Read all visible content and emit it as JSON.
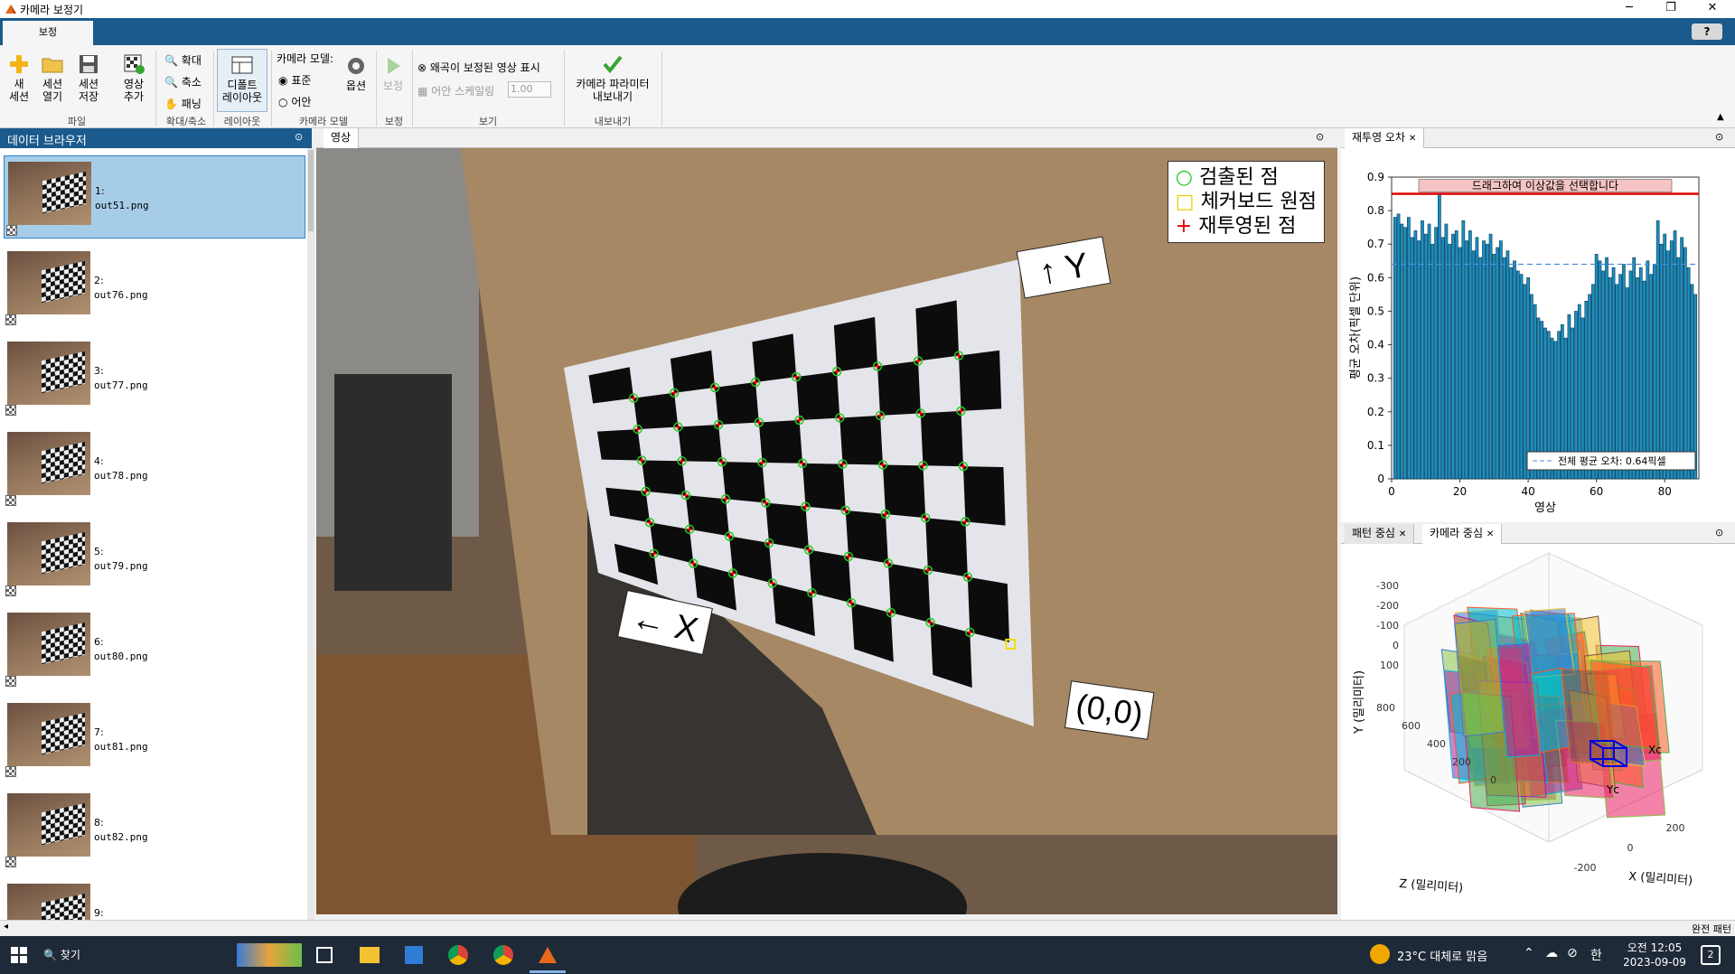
{
  "window": {
    "title": "카메라 보정기"
  },
  "ribbon": {
    "tab_label": "보정",
    "help": "?",
    "groups": {
      "file": {
        "label": "파일",
        "new_session": "새\n세션",
        "open_session": "세션\n열기",
        "save_session": "세션\n저장",
        "add_images": "영상\n추가"
      },
      "zoom": {
        "label": "확대/축소",
        "zoom_in": "확대",
        "zoom_out": "축소",
        "pan": "패닝"
      },
      "layout": {
        "label": "레이아웃",
        "default_layout": "디폴트\n레이아웃"
      },
      "camera_model": {
        "label": "카메라 모델",
        "title": "카메라 모델:",
        "standard": "표준",
        "fisheye": "어안",
        "options": "옵션",
        "standard_selected": true
      },
      "calibrate": {
        "label": "보정",
        "button": "보정"
      },
      "view": {
        "label": "보기",
        "show_undistorted": "왜곡이 보정된 영상 표시",
        "fisheye_scaling": "어안 스케일링",
        "scaling_value": "1.00"
      },
      "export": {
        "label": "내보내기",
        "button": "카메라 파라미터\n내보내기"
      }
    }
  },
  "browser": {
    "title": "데이터 브라우저",
    "items": [
      {
        "num": "1:",
        "file": "out51.png",
        "selected": true
      },
      {
        "num": "2:",
        "file": "out76.png"
      },
      {
        "num": "3:",
        "file": "out77.png"
      },
      {
        "num": "4:",
        "file": "out78.png"
      },
      {
        "num": "5:",
        "file": "out79.png"
      },
      {
        "num": "6:",
        "file": "out80.png"
      },
      {
        "num": "7:",
        "file": "out81.png"
      },
      {
        "num": "8:",
        "file": "out82.png"
      },
      {
        "num": "9:",
        "file": ""
      }
    ]
  },
  "image_panel": {
    "tab": "영상",
    "legend": {
      "detected": "검출된 점",
      "origin": "체커보드 원점",
      "reprojected": "재투영된 점"
    },
    "axis_y": "↑ Y",
    "axis_x": "← X",
    "origin_label": "(0,0)",
    "colors": {
      "detected": "#22cc22",
      "origin": "#f2e000",
      "reprojected": "#e00000"
    }
  },
  "error_panel": {
    "tab": "재투영 오차",
    "hint": "드래그하여 이상값을 선택합니다",
    "legend": "전체 평균 오차: 0.64픽셀",
    "ylabel": "평균 오차(픽셀 단위)",
    "xlabel": "영상"
  },
  "chart_data": {
    "type": "bar",
    "title": "",
    "xlabel": "영상",
    "ylabel": "평균 오차(픽셀 단위)",
    "ylim": [
      0,
      0.9
    ],
    "xlim": [
      0,
      90
    ],
    "xticks": [
      0,
      20,
      40,
      60,
      80
    ],
    "yticks": [
      0,
      0.1,
      0.2,
      0.3,
      0.4,
      0.5,
      0.6,
      0.7,
      0.8,
      0.9
    ],
    "threshold": 0.85,
    "mean": 0.64,
    "bar_color": "#1b8fc0",
    "values": [
      0.78,
      0.79,
      0.76,
      0.75,
      0.78,
      0.72,
      0.74,
      0.71,
      0.77,
      0.73,
      0.76,
      0.7,
      0.75,
      0.85,
      0.72,
      0.76,
      0.7,
      0.73,
      0.74,
      0.69,
      0.77,
      0.71,
      0.74,
      0.68,
      0.72,
      0.66,
      0.71,
      0.7,
      0.73,
      0.67,
      0.69,
      0.71,
      0.66,
      0.68,
      0.63,
      0.65,
      0.62,
      0.61,
      0.58,
      0.6,
      0.55,
      0.52,
      0.48,
      0.47,
      0.45,
      0.44,
      0.42,
      0.41,
      0.44,
      0.46,
      0.42,
      0.49,
      0.45,
      0.5,
      0.52,
      0.48,
      0.53,
      0.55,
      0.58,
      0.67,
      0.65,
      0.62,
      0.66,
      0.6,
      0.63,
      0.58,
      0.61,
      0.64,
      0.57,
      0.62,
      0.66,
      0.6,
      0.63,
      0.59,
      0.65,
      0.61,
      0.64,
      0.77,
      0.7,
      0.73,
      0.68,
      0.71,
      0.74,
      0.66,
      0.72,
      0.69,
      0.63,
      0.58,
      0.55
    ]
  },
  "extrinsics_panel": {
    "tab_pattern": "패턴 중심",
    "tab_camera": "카메라 중심",
    "ylabel": "Y (밀리미터)",
    "zlabel": "Z (밀리미터)",
    "xlabel": "X (밀리미터)",
    "y_ticks": [
      "-300",
      "-200",
      "-100",
      "0",
      "100"
    ],
    "z_ticks": [
      "800",
      "600",
      "400",
      "200",
      "0"
    ],
    "x_ticks": [
      "-200",
      "0",
      "200"
    ],
    "xc": "Xc",
    "yc": "Yc"
  },
  "status": {
    "text": "완전 패턴"
  },
  "taskbar": {
    "search": "찾기",
    "weather": "23°C  대체로 맑음",
    "time": "오전 12:05",
    "date": "2023-09-09",
    "notif": "2"
  }
}
